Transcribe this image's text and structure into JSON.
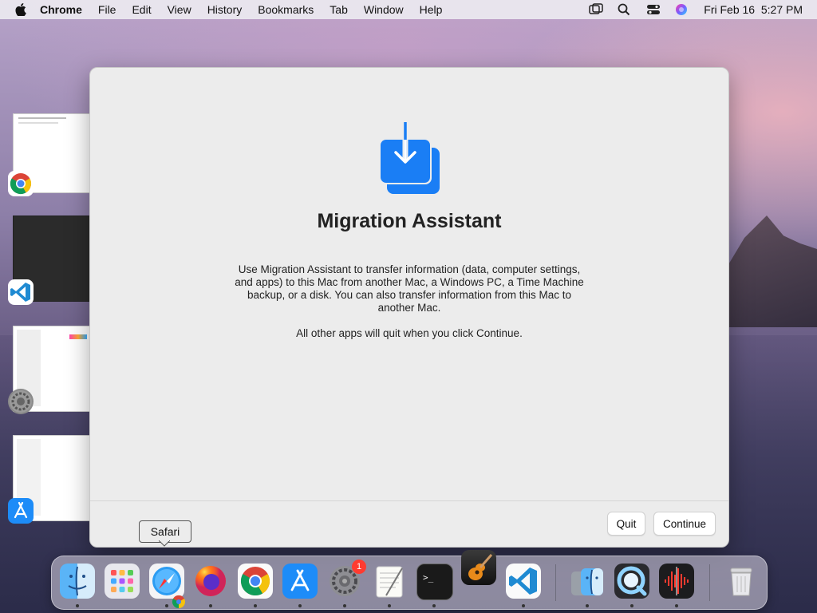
{
  "menubar": {
    "app_name": "Chrome",
    "items": [
      "File",
      "Edit",
      "View",
      "History",
      "Bookmarks",
      "Tab",
      "Window",
      "Help"
    ],
    "clock": "Fri Feb 16  5:27 PM"
  },
  "window": {
    "title": "Migration Assistant",
    "description": "Use Migration Assistant to transfer information (data, computer settings, and apps) to this Mac from another Mac, a Windows PC, a Time Machine backup, or a disk. You can also transfer information from this Mac to another Mac.",
    "note": "All other apps will quit when you click Continue.",
    "quit_label": "Quit",
    "continue_label": "Continue",
    "icon_color": "#1a7ef5"
  },
  "tooltip": {
    "text": "Safari"
  },
  "dock": {
    "apps": [
      {
        "name": "Finder",
        "icon": "finder-icon"
      },
      {
        "name": "Launchpad",
        "icon": "launchpad-icon"
      },
      {
        "name": "Safari",
        "icon": "safari-icon"
      },
      {
        "name": "Firefox",
        "icon": "firefox-icon"
      },
      {
        "name": "Chrome",
        "icon": "chrome-icon"
      },
      {
        "name": "App Store",
        "icon": "app-store-icon"
      },
      {
        "name": "System Preferences",
        "icon": "system-preferences-icon",
        "badge": "1"
      },
      {
        "name": "TextEdit",
        "icon": "textedit-icon"
      },
      {
        "name": "Terminal",
        "icon": "terminal-icon"
      },
      {
        "name": "GarageBand",
        "icon": "garageband-icon"
      },
      {
        "name": "Visual Studio Code",
        "icon": "vscode-icon"
      },
      {
        "name": "Migration Assistant",
        "icon": "migration-finder-icon"
      },
      {
        "name": "QuickTime Player",
        "icon": "quicktime-icon"
      },
      {
        "name": "Voice Memos",
        "icon": "voice-memos-icon"
      },
      {
        "name": "Trash",
        "icon": "trash-icon"
      }
    ],
    "badge_count": "1"
  }
}
